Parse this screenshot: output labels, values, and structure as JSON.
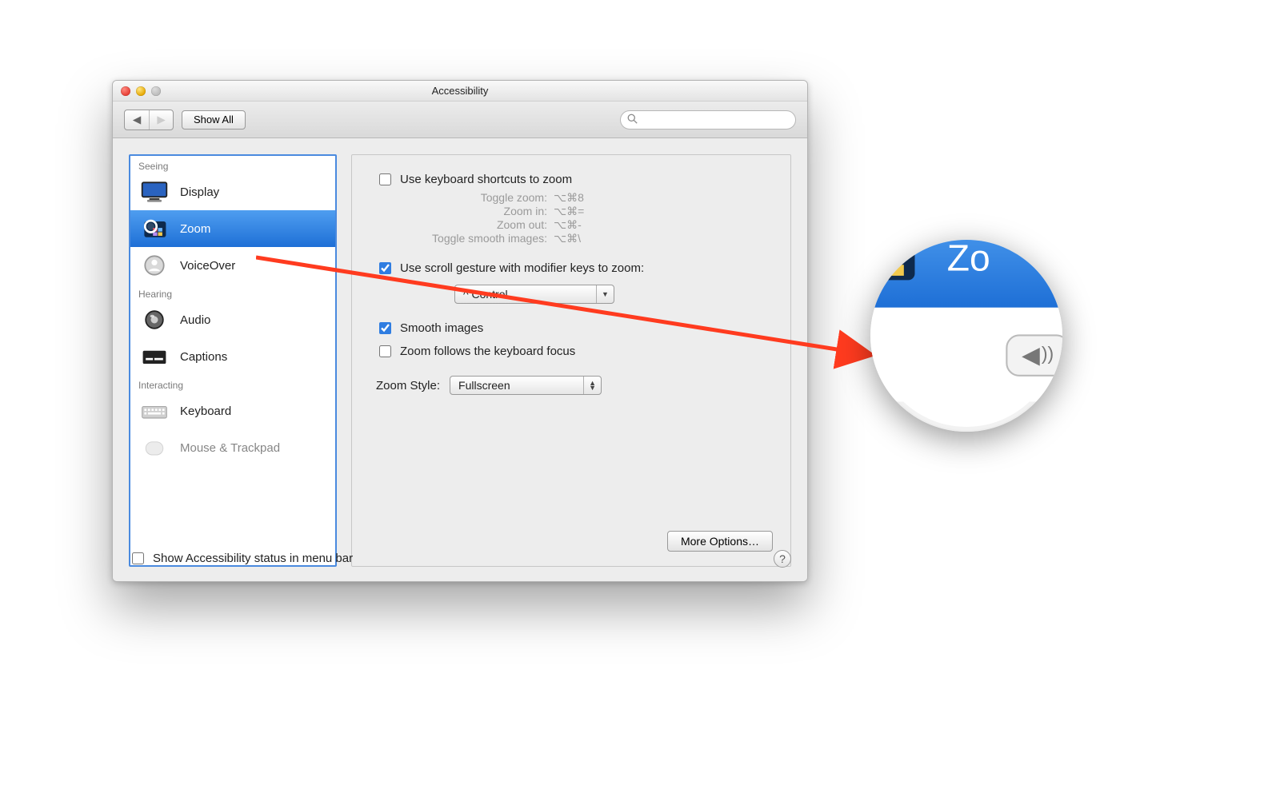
{
  "window": {
    "title": "Accessibility"
  },
  "toolbar": {
    "show_all": "Show All",
    "search_placeholder": ""
  },
  "sidebar": {
    "groups": [
      {
        "label": "Seeing"
      },
      {
        "label": "Hearing"
      },
      {
        "label": "Interacting"
      }
    ],
    "items": {
      "display": "Display",
      "zoom": "Zoom",
      "voiceover": "VoiceOver",
      "audio": "Audio",
      "captions": "Captions",
      "keyboard": "Keyboard",
      "mouse": "Mouse & Trackpad"
    }
  },
  "zoom_panel": {
    "use_kb": "Use keyboard shortcuts to zoom",
    "shortcuts": {
      "toggle_zoom_k": "Toggle zoom:",
      "toggle_zoom_v": "⌥⌘8",
      "zoom_in_k": "Zoom in:",
      "zoom_in_v": "⌥⌘=",
      "zoom_out_k": "Zoom out:",
      "zoom_out_v": "⌥⌘-",
      "toggle_smooth_k": "Toggle smooth images:",
      "toggle_smooth_v": "⌥⌘\\"
    },
    "use_scroll": "Use scroll gesture with modifier keys to zoom:",
    "modifier_selected": "^ Control",
    "smooth_images": "Smooth images",
    "follows_focus": "Zoom follows the keyboard focus",
    "zoom_style_label": "Zoom Style:",
    "zoom_style_selected": "Fullscreen",
    "more_options": "More Options…"
  },
  "bottom": {
    "show_status": "Show Accessibility status in menu bar"
  },
  "loupe": {
    "zoom_label": "Zo"
  }
}
